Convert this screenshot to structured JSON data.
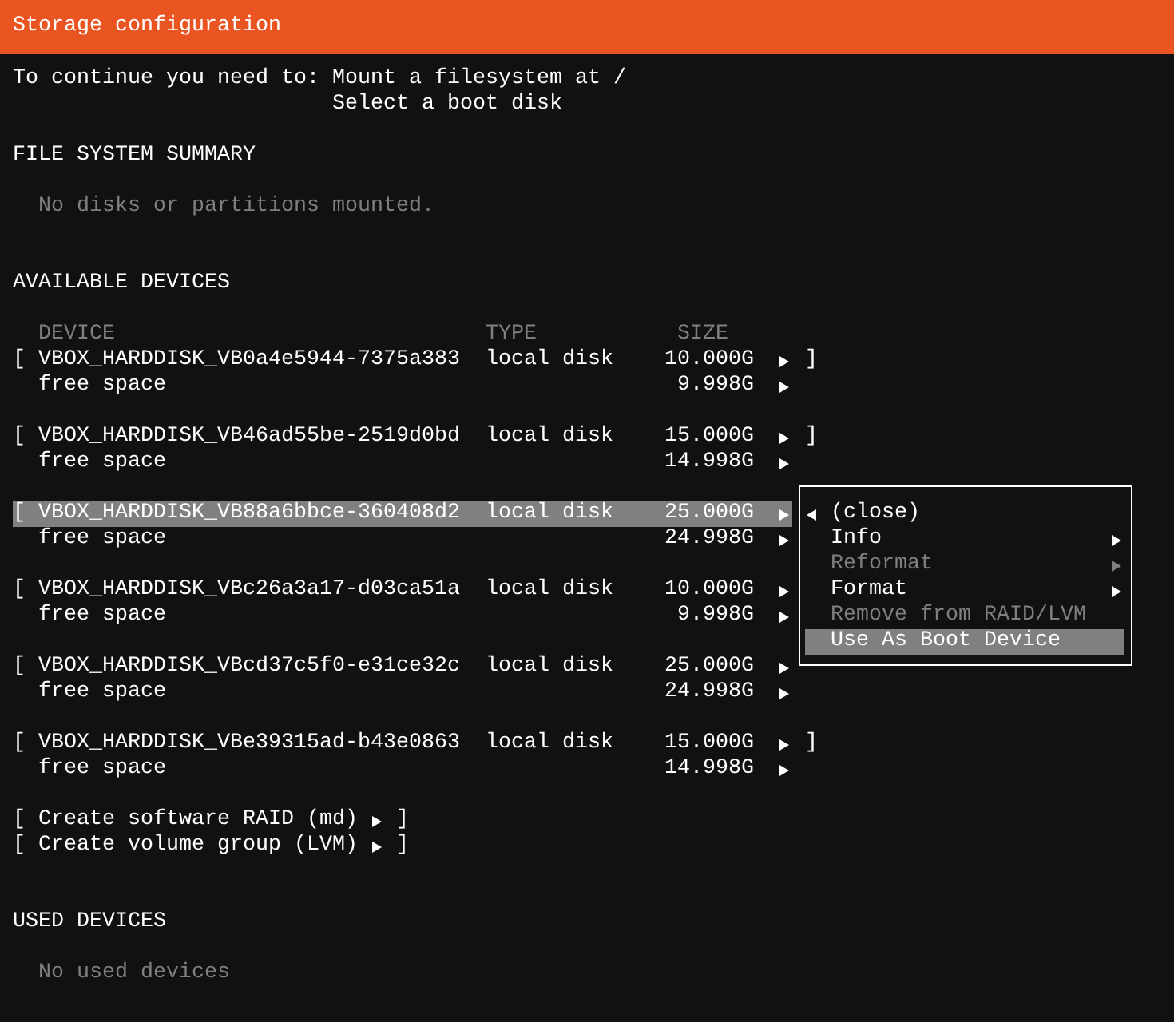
{
  "window": {
    "title": "Storage configuration"
  },
  "requirements": {
    "label": "To continue you need to:",
    "items": [
      "Mount a filesystem at /",
      "Select a boot disk"
    ]
  },
  "file_system_summary": {
    "heading": "FILE SYSTEM SUMMARY",
    "message": "No disks or partitions mounted."
  },
  "available_devices": {
    "heading": "AVAILABLE DEVICES",
    "columns": [
      "DEVICE",
      "TYPE",
      "SIZE"
    ],
    "devices": [
      {
        "bracket_open": "[",
        "name": "VBOX_HARDDISK_VB0a4e5944-7375a383",
        "type": "local disk",
        "size": "10.000G",
        "bracket_close": "]",
        "selected": false,
        "partitions": [
          {
            "name": "free space",
            "size": "9.998G"
          }
        ]
      },
      {
        "bracket_open": "[",
        "name": "VBOX_HARDDISK_VB46ad55be-2519d0bd",
        "type": "local disk",
        "size": "15.000G",
        "bracket_close": "]",
        "selected": false,
        "partitions": [
          {
            "name": "free space",
            "size": "14.998G"
          }
        ]
      },
      {
        "bracket_open": "[",
        "name": "VBOX_HARDDISK_VB88a6bbce-360408d2",
        "type": "local disk",
        "size": "25.000G",
        "selected": true,
        "partitions": [
          {
            "name": "free space",
            "size": "24.998G"
          }
        ]
      },
      {
        "bracket_open": "[",
        "name": "VBOX_HARDDISK_VBc26a3a17-d03ca51a",
        "type": "local disk",
        "size": "10.000G",
        "selected": false,
        "partitions": [
          {
            "name": "free space",
            "size": "9.998G"
          }
        ]
      },
      {
        "bracket_open": "[",
        "name": "VBOX_HARDDISK_VBcd37c5f0-e31ce32c",
        "type": "local disk",
        "size": "25.000G",
        "selected": false,
        "partitions": [
          {
            "name": "free space",
            "size": "24.998G"
          }
        ]
      },
      {
        "bracket_open": "[",
        "name": "VBOX_HARDDISK_VBe39315ad-b43e0863",
        "type": "local disk",
        "size": "15.000G",
        "bracket_close": "]",
        "selected": false,
        "partitions": [
          {
            "name": "free space",
            "size": "14.998G"
          }
        ]
      }
    ],
    "actions": [
      {
        "bracket_open": "[",
        "label": "Create software RAID (md)",
        "bracket_close": "]"
      },
      {
        "bracket_open": "[",
        "label": "Create volume group (LVM)",
        "bracket_close": "]"
      }
    ]
  },
  "device_menu": {
    "items": [
      {
        "kind": "close",
        "label": "(close)",
        "disabled": false,
        "selected": false
      },
      {
        "kind": "submenu",
        "label": "Info",
        "disabled": false,
        "selected": false
      },
      {
        "kind": "submenu",
        "label": "Reformat",
        "disabled": true,
        "selected": false
      },
      {
        "kind": "submenu",
        "label": "Format",
        "disabled": false,
        "selected": false
      },
      {
        "kind": "action",
        "label": "Remove from RAID/LVM",
        "disabled": true,
        "selected": false
      },
      {
        "kind": "action",
        "label": "Use As Boot Device",
        "disabled": false,
        "selected": true
      }
    ]
  },
  "used_devices": {
    "heading": "USED DEVICES",
    "message": "No used devices"
  }
}
